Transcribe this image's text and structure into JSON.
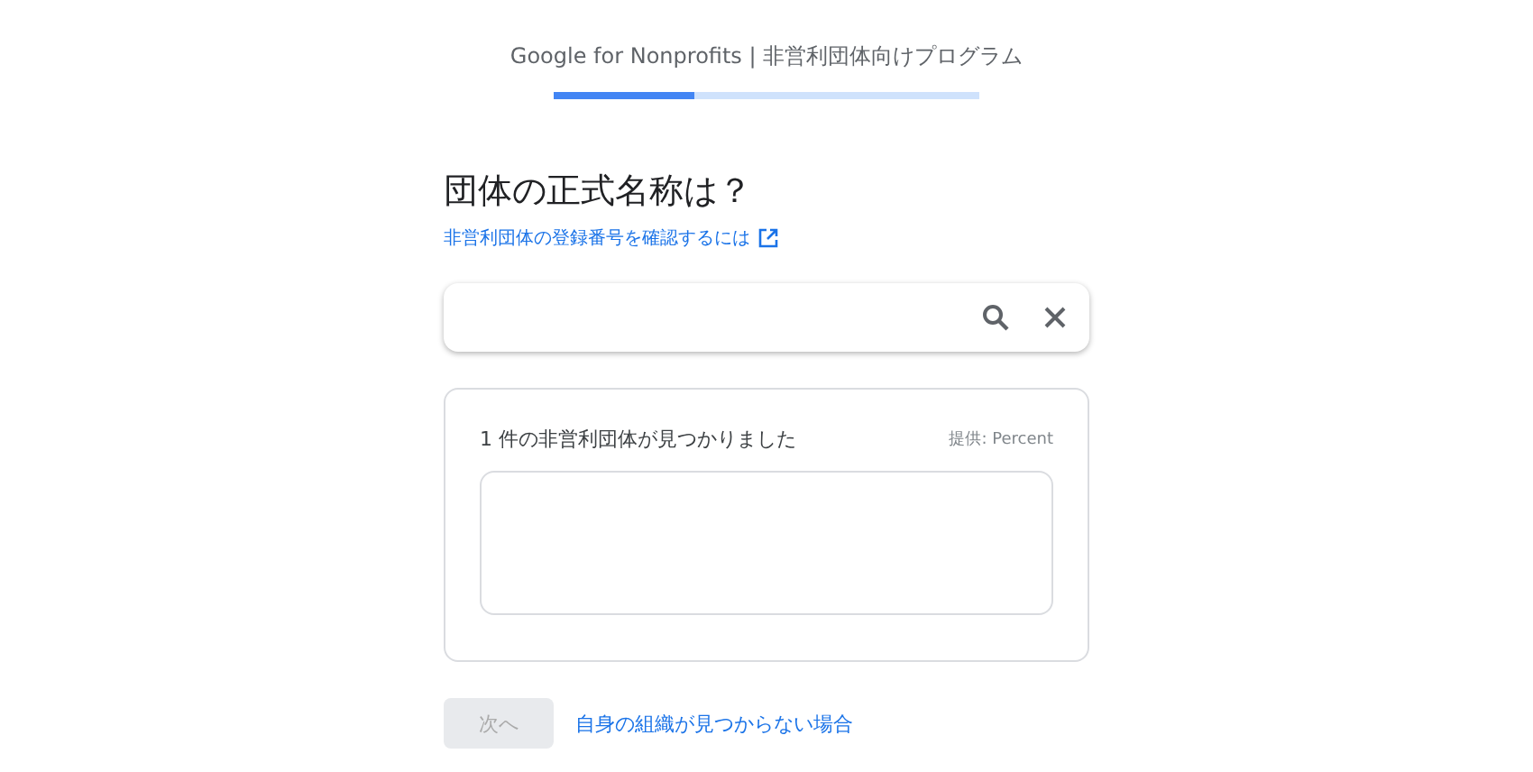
{
  "header": {
    "title": "Google for Nonprofits | 非営利団体向けプログラム",
    "progress": {
      "level": 0.33
    }
  },
  "question": {
    "title": "団体の正式名称は？",
    "help_link": "非営利団体の登録番号を確認するには"
  },
  "results": {
    "count_text": "1 件の非営利団体が見つかりました",
    "provider": "提供: Percent"
  },
  "footer": {
    "next_button": {
      "label": "次へ",
      "disabled": true
    },
    "not_found_link": "自身の組織が見つからない場合"
  }
}
